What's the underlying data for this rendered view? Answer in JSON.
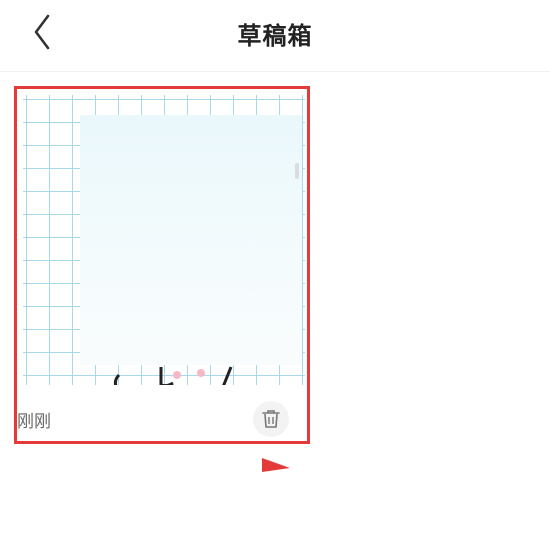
{
  "header": {
    "title": "草稿箱",
    "back_icon": "chevron-left-icon"
  },
  "drafts": [
    {
      "time": "刚刚",
      "delete_icon": "trash-icon"
    }
  ],
  "colors": {
    "selection_border": "#e43a3a",
    "grid_line": "#a8d8ea",
    "title_text": "#222222",
    "meta_text": "#666666"
  }
}
